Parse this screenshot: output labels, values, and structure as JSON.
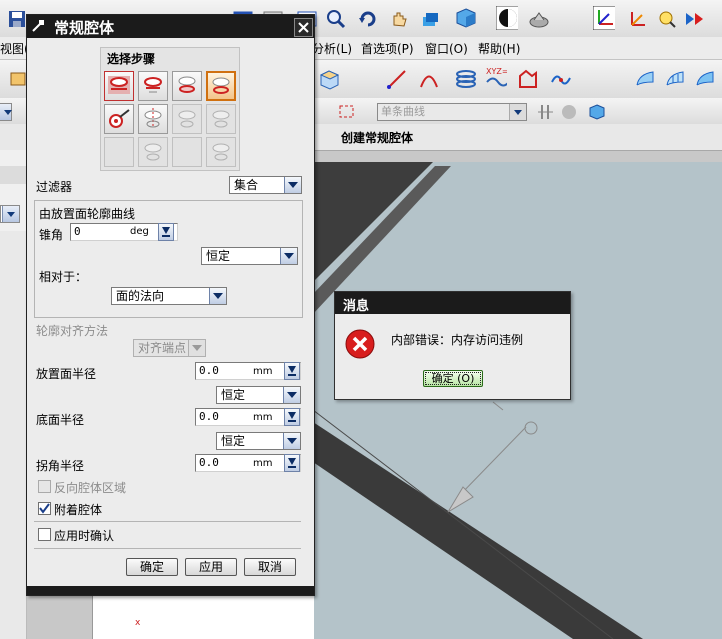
{
  "app": {
    "menu": [
      "视图(",
      "分析(L)",
      "首选项(P)",
      "窗口(O)",
      "帮助(H)"
    ],
    "filter_combo_placeholder": "单条曲线",
    "hint_text": "创建常规腔体"
  },
  "dialog": {
    "title": "常规腔体",
    "steps_label": "选择步骤",
    "filter_label": "过滤器",
    "filter_value": "集合",
    "group_title": "由放置面轮廓曲线",
    "taper_label": "锥角",
    "taper_value": "0",
    "taper_unit": "deg",
    "taper_mode": "恒定",
    "relative_label": "相对于：",
    "relative_value": "面的法向",
    "align_label": "轮廓对齐方法",
    "align_value": "对齐端点",
    "placement_radius_label": "放置面半径",
    "placement_radius_value": "0.0",
    "placement_radius_unit": "mm",
    "placement_radius_mode": "恒定",
    "floor_radius_label": "底面半径",
    "floor_radius_value": "0.0",
    "floor_radius_unit": "mm",
    "floor_radius_mode": "恒定",
    "corner_radius_label": "拐角半径",
    "corner_radius_value": "0.0",
    "corner_radius_unit": "mm",
    "reverse_label": "反向腔体区域",
    "attach_label": "附着腔体",
    "confirm_on_apply_label": "应用时确认",
    "ok_label": "确定",
    "apply_label": "应用",
    "cancel_label": "取消"
  },
  "message": {
    "title": "消息",
    "text": "内部错误：内存访问违例",
    "ok_label": "确定 (O)"
  },
  "colors": {
    "title_bar": "#1b1b1b",
    "viewport": "#b4c3c9",
    "error_red": "#d81e1e",
    "accent_blue": "#1f4fb4"
  }
}
